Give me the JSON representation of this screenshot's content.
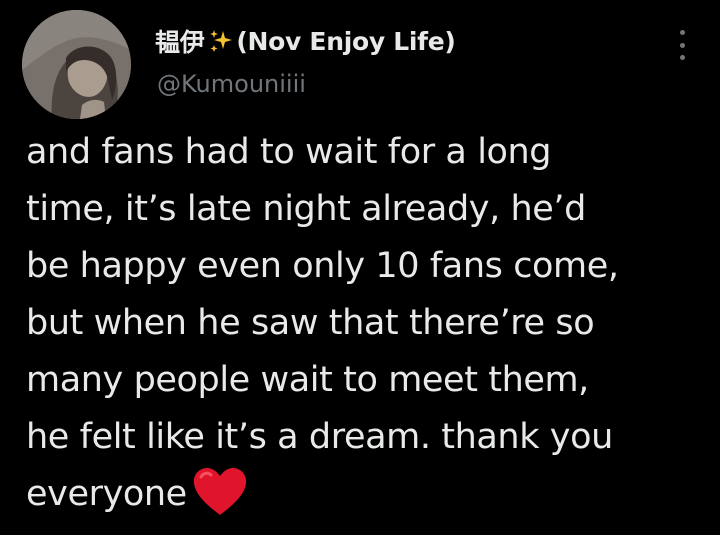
{
  "tweet": {
    "display_name_prefix": "韫伊",
    "display_name_suffix": "(Nov Enjoy Life)",
    "handle": "@Kumouniiii",
    "text_lines": [
      "and fans had to wait for a long",
      "time, it’s late night already, he’d",
      "be happy even only 10 fans come,",
      "but when he saw that there’re so",
      "many people wait to meet them,",
      "he felt like it’s a dream. thank you",
      "everyone"
    ],
    "emoji": "heart"
  },
  "icons": {
    "sparkle": "sparkles-icon",
    "heart": "red-heart-icon",
    "more": "more-options-icon"
  },
  "colors": {
    "background": "#000000",
    "text": "#e7e9ea",
    "secondary": "#71767b",
    "sparkle": "#f4c430",
    "heart": "#e0142b"
  }
}
